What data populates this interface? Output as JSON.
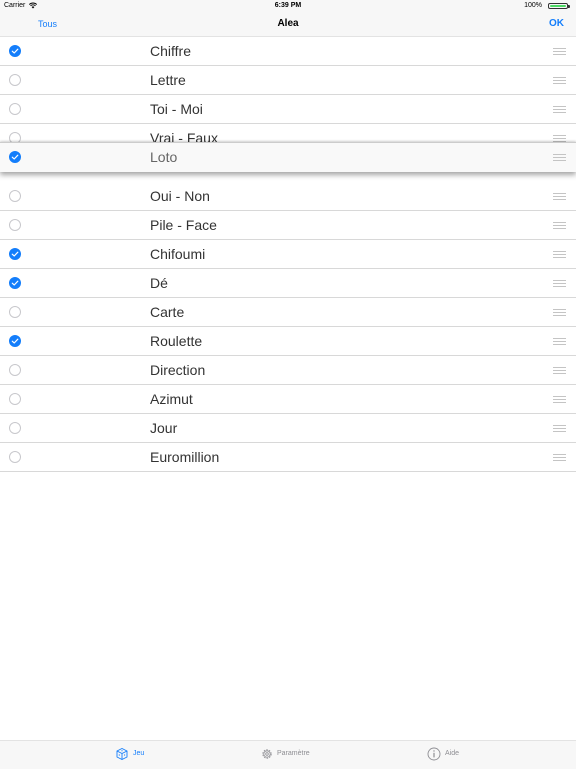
{
  "status_bar": {
    "carrier": "Carrier",
    "time": "6:39 PM",
    "battery": "100%",
    "battery_level": 1.0
  },
  "nav": {
    "left_button": "Tous",
    "title": "Alea",
    "right_button": "OK"
  },
  "items": [
    {
      "label": "Chiffre",
      "checked": true
    },
    {
      "label": "Lettre",
      "checked": false
    },
    {
      "label": "Toi - Moi",
      "checked": false
    },
    {
      "label": "Vrai - Faux",
      "checked": false
    },
    {
      "label": "Loto",
      "checked": true
    },
    {
      "label": "Oui - Non",
      "checked": false
    },
    {
      "label": "Pile - Face",
      "checked": false
    },
    {
      "label": "Chifoumi",
      "checked": true
    },
    {
      "label": "Dé",
      "checked": true
    },
    {
      "label": "Carte",
      "checked": false
    },
    {
      "label": "Roulette",
      "checked": true
    },
    {
      "label": "Direction",
      "checked": false
    },
    {
      "label": "Azimut",
      "checked": false
    },
    {
      "label": "Jour",
      "checked": false
    },
    {
      "label": "Euromillion",
      "checked": false
    }
  ],
  "tabs": [
    {
      "label": "Jeu",
      "icon": "dice-icon",
      "active": true
    },
    {
      "label": "Paramètre",
      "icon": "gear-icon",
      "active": false
    },
    {
      "label": "Aide",
      "icon": "info-icon",
      "active": false
    }
  ],
  "colors": {
    "accent": "#147efb",
    "inactive": "#8e8e93"
  }
}
